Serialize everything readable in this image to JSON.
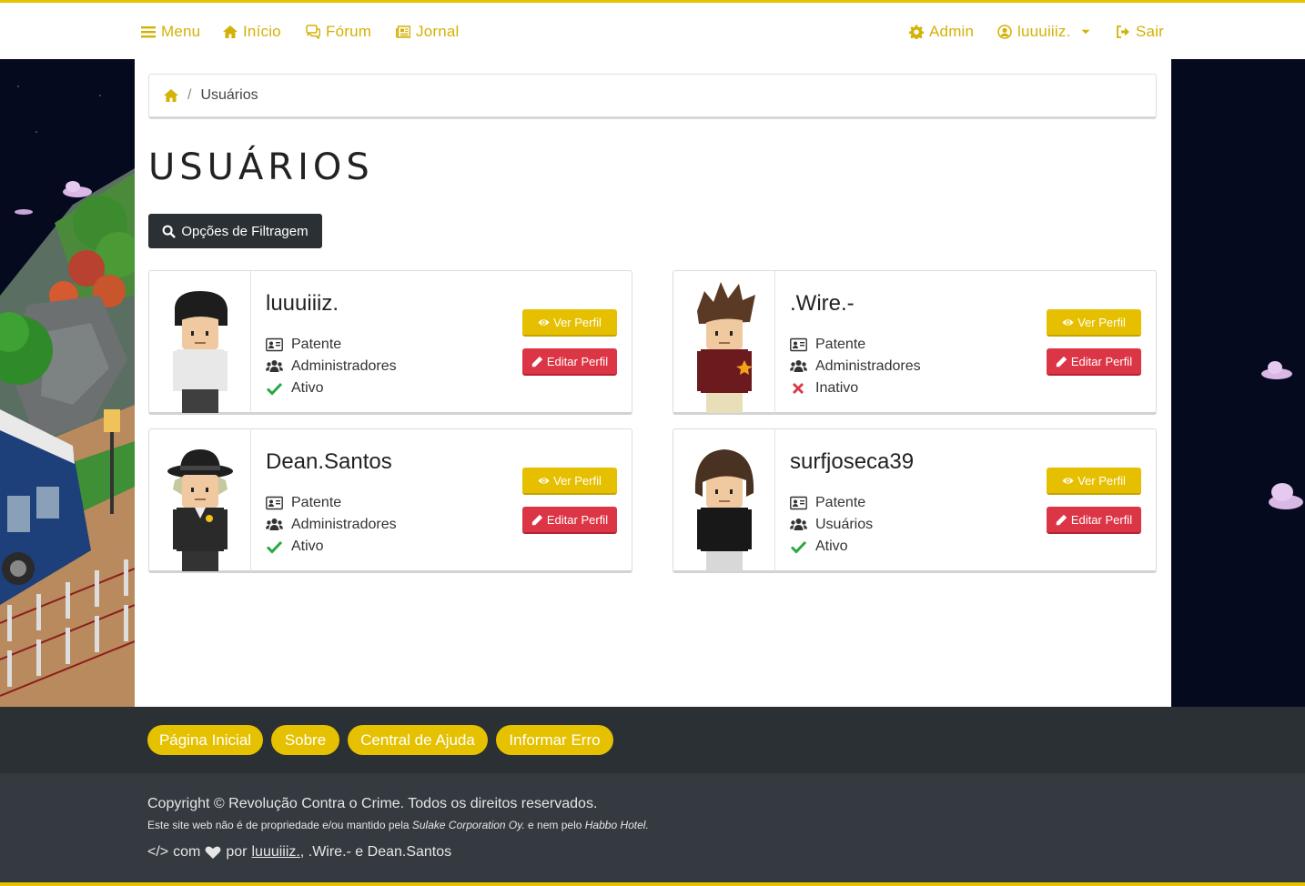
{
  "nav": {
    "menu": "Menu",
    "inicio": "Início",
    "forum": "Fórum",
    "jornal": "Jornal",
    "admin": "Admin",
    "user": "luuuiiiz.",
    "sair": "Sair"
  },
  "breadcrumb": {
    "current": "Usuários"
  },
  "page": {
    "title": "USUÁRIOS",
    "filter_button": "Opções de Filtragem"
  },
  "cards": [
    {
      "username": "luuuiiiz.",
      "rank": "Patente",
      "group": "Administradores",
      "status": "Ativo",
      "view": "Ver Perfil",
      "edit": "Editar Perfil"
    },
    {
      "username": ".Wire.-",
      "rank": "Patente",
      "group": "Administradores",
      "status": "Inativo",
      "view": "Ver Perfil",
      "edit": "Editar Perfil"
    },
    {
      "username": "Dean.Santos",
      "rank": "Patente",
      "group": "Administradores",
      "status": "Ativo",
      "view": "Ver Perfil",
      "edit": "Editar Perfil"
    },
    {
      "username": "surfjoseca39",
      "rank": "Patente",
      "group": "Usuários",
      "status": "Ativo",
      "view": "Ver Perfil",
      "edit": "Editar Perfil"
    }
  ],
  "footer": {
    "links": [
      "Página Inicial",
      "Sobre",
      "Central de Ajuda",
      "Informar Erro"
    ],
    "copyright": "Copyright © Revolução Contra o Crime. Todos os direitos reservados.",
    "disclaimer_a": "Este site web não é de propriedade e/ou mantido pela ",
    "disclaimer_sulake": "Sulake Corporation Oy.",
    "disclaimer_b": " e nem pelo ",
    "disclaimer_habbo": "Habbo Hotel.",
    "credits_code": "</>",
    "credits_com": "com",
    "credits_por": "por",
    "credits_author1": "luuuiiiz.",
    "credits_rest": ", .Wire.- e Dean.Santos"
  },
  "colors": {
    "accent": "#e5c100",
    "danger": "#dc3545",
    "success": "#27a844",
    "dark": "#343a40"
  }
}
